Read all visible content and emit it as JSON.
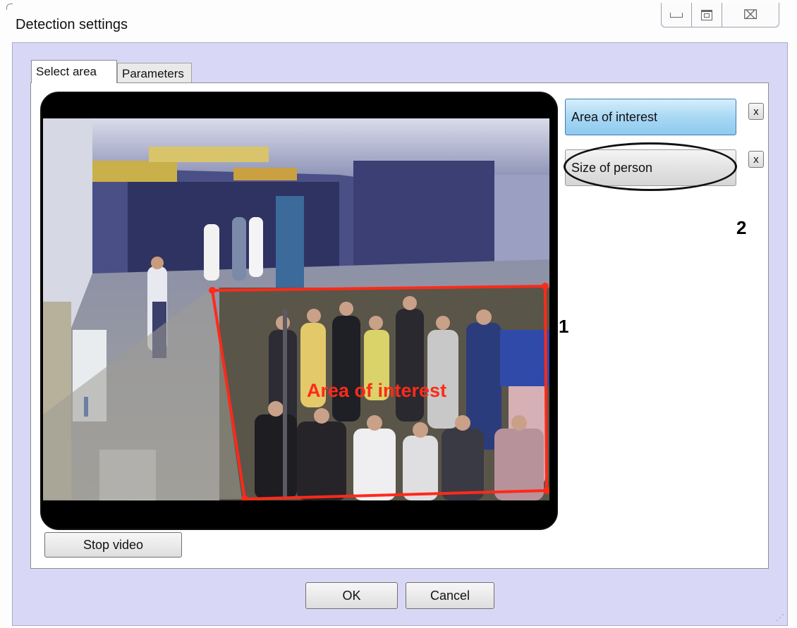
{
  "window": {
    "title": "Detection settings",
    "controls": {
      "minimize": "—",
      "maximize": "▣",
      "close": "☒"
    }
  },
  "tabs": [
    {
      "label": "Select area",
      "selected": true
    },
    {
      "label": "Parameters",
      "selected": false
    }
  ],
  "video": {
    "overlay_label": "Area of interest",
    "overlay_color": "#ff2a1a"
  },
  "zones": [
    {
      "label": "Area of interest",
      "remove_label": "x",
      "selected": true
    },
    {
      "label": "Size of person",
      "remove_label": "x",
      "selected": false
    }
  ],
  "annotations": {
    "marker_1": "1",
    "marker_2": "2"
  },
  "buttons": {
    "stop_video": "Stop video",
    "ok": "OK",
    "cancel": "Cancel"
  },
  "colors": {
    "dialog_background": "#d8d8f6",
    "selected_zone": "#a9d8f4",
    "area_outline": "#ff2a1a"
  }
}
